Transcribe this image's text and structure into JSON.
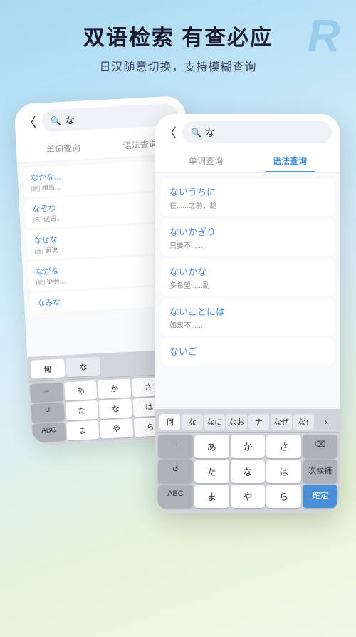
{
  "header": {
    "title": "双语检索 有查必应",
    "subtitle": "日汉随意切换，支持模糊查询",
    "r_logo": "R"
  },
  "back_phone": {
    "search_back_arrow": "〈",
    "search_icon": "🔍",
    "search_query": "な",
    "tabs": [
      {
        "label": "单词查询",
        "active": false
      },
      {
        "label": "语法查询",
        "active": false
      }
    ],
    "results": [
      {
        "jp": "なかな...",
        "tag": "[副]",
        "cn": "相当..."
      },
      {
        "jp": "なぞな",
        "tag": "[名]",
        "cn": "谜语..."
      },
      {
        "jp": "なぜな",
        "tag": "[连]",
        "cn": "表说..."
      },
      {
        "jp": "ながな",
        "tag": "[副]",
        "cn": "徒劳..."
      },
      {
        "jp": "なみな",
        "tag": "",
        "cn": ""
      }
    ],
    "keyboard_suggestions": [
      "何",
      "な"
    ],
    "keyboard_rows": [
      [
        {
          "label": "→",
          "dark": true
        },
        {
          "label": "あ"
        },
        {
          "label": "か"
        },
        {
          "label": "さ"
        },
        {
          "label": "⌫",
          "dark": true
        }
      ],
      [
        {
          "label": "↺",
          "dark": true
        },
        {
          "label": "た"
        },
        {
          "label": "な"
        },
        {
          "label": "は"
        },
        {
          "label": "次候補",
          "dark": true
        }
      ],
      [
        {
          "label": "ABC",
          "dark": true
        },
        {
          "label": "ま"
        },
        {
          "label": "や"
        },
        {
          "label": "ら"
        },
        {
          "label": "確定",
          "action": true
        }
      ]
    ]
  },
  "front_phone": {
    "search_back_arrow": "〈",
    "search_icon": "🔍",
    "search_query": "な",
    "tabs": [
      {
        "label": "单词查询",
        "active": false
      },
      {
        "label": "语法查询",
        "active": true
      }
    ],
    "results": [
      {
        "jp": "ないうちに",
        "cn": "在......之前，趁"
      },
      {
        "jp": "ないかぎり",
        "cn": "只要不......"
      },
      {
        "jp": "ないかな",
        "cn": "多希望......副"
      },
      {
        "jp": "ないことには",
        "cn": "如果不......"
      },
      {
        "jp": "ないご",
        "cn": ""
      }
    ],
    "keyboard_suggestions": [
      {
        "label": "何",
        "active": false
      },
      {
        "label": "な",
        "active": false
      },
      {
        "label": "なに",
        "active": false
      },
      {
        "label": "なお",
        "active": false
      },
      {
        "label": "ナ",
        "active": false
      },
      {
        "label": "なぜ",
        "active": false
      },
      {
        "label": "な↑",
        "active": false
      },
      {
        "label": "›",
        "active": false
      }
    ],
    "keyboard_rows": [
      [
        {
          "label": "→",
          "dark": true
        },
        {
          "label": "あ"
        },
        {
          "label": "か"
        },
        {
          "label": "さ"
        },
        {
          "label": "⌫",
          "dark": true
        }
      ],
      [
        {
          "label": "↺",
          "dark": true
        },
        {
          "label": "た"
        },
        {
          "label": "な"
        },
        {
          "label": "は"
        },
        {
          "label": "次候補",
          "dark": true
        }
      ],
      [
        {
          "label": "ABC",
          "dark": true
        },
        {
          "label": "ま"
        },
        {
          "label": "や"
        },
        {
          "label": "ら"
        },
        {
          "label": "確定",
          "action": true
        }
      ]
    ]
  }
}
